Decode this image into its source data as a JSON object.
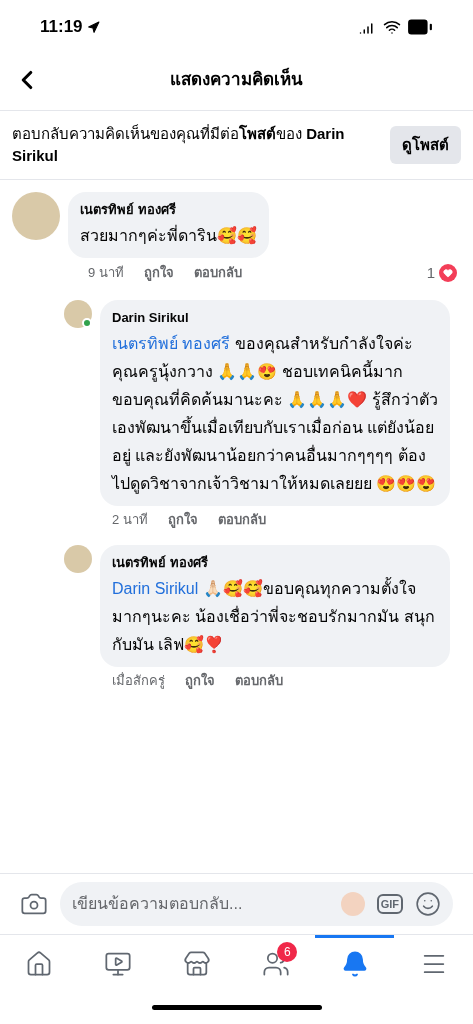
{
  "status_bar": {
    "time": "11:19"
  },
  "header": {
    "title": "แสดงความคิดเห็น"
  },
  "context": {
    "text": "ตอบกลับความคิดเห็นของคุณที่มีต่อ**โพสต์**ของ **Darin Sirikul**",
    "button": "ดูโพสต์"
  },
  "comments": [
    {
      "author": "เนตรทิพย์ ทองศรี",
      "text": "สวยมากๆค่ะพี่ดาริน🥰🥰",
      "time": "9 นาที",
      "like": "ถูกใจ",
      "reply": "ตอบกลับ",
      "reactions": "1",
      "online": false,
      "children": [
        {
          "author": "Darin Sirikul",
          "mention": "เนตรทิพย์ ทองศรี",
          "text": " ของคุณสำหรับกำลังใจค่ะ คุณครูนุ้งกวาง 🙏🙏😍  ชอบเทคนิคนี้มาก ขอบคุณที่คิดค้นมานะคะ 🙏🙏🙏❤️ รู้สึกว่าตัวเองพัฒนาขึ้นเมื่อเทียบกับเราเมื่อก่อน แต่ยังน้อยอยู่ และยังพัฒนาน้อยกว่าคนอื่นมากๆๆๆๆ ต้องไปดูดวิชาจากเจ้าวิชามาให้หมดเลยยย 😍😍😍",
          "time": "2 นาที",
          "like": "ถูกใจ",
          "reply": "ตอบกลับ",
          "online": true
        },
        {
          "author": "เนตรทิพย์ ทองศรี",
          "mention": "Darin Sirikul",
          "text": " 🙏🏻🥰🥰ขอบคุณทุกความตั้งใจมากๆนะคะ น้องเชื่อว่าพี่จะชอบรักมากมัน สนุกกับมัน เลิฟ🥰❣️",
          "time": "เมื่อสักครู่",
          "like": "ถูกใจ",
          "reply": "ตอบกลับ",
          "online": false
        }
      ]
    }
  ],
  "composer": {
    "placeholder": "เขียนข้อความตอบกลับ...",
    "gif": "GIF"
  },
  "tabs": [
    {
      "kind": "home",
      "selected": false
    },
    {
      "kind": "video",
      "selected": false
    },
    {
      "kind": "market",
      "selected": false
    },
    {
      "kind": "groups",
      "selected": false,
      "badge": "6"
    },
    {
      "kind": "bell",
      "selected": true
    },
    {
      "kind": "menu",
      "selected": false
    }
  ]
}
